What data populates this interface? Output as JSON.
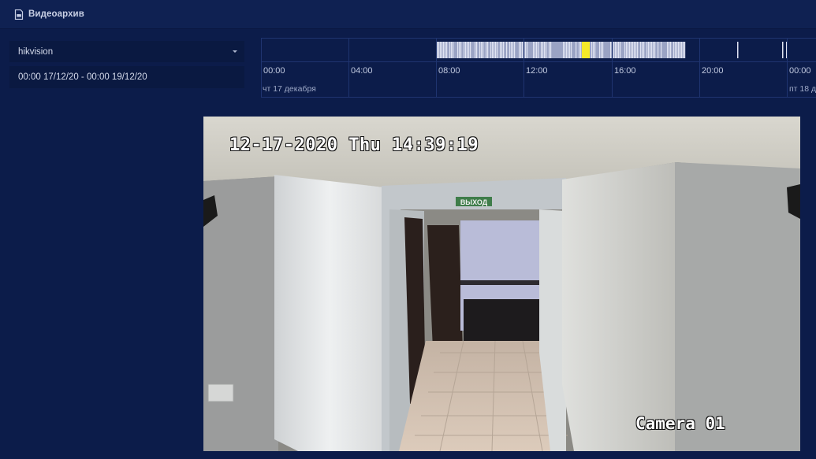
{
  "header": {
    "title": "Видеоархив",
    "icon": "document-video-icon"
  },
  "filters": {
    "camera_select": {
      "value": "hikvision"
    },
    "date_range": {
      "value": "00:00 17/12/20 - 00:00 19/12/20"
    }
  },
  "timeline": {
    "hour_labels": [
      "00:00",
      "04:00",
      "08:00",
      "12:00",
      "16:00",
      "20:00",
      "00:00"
    ],
    "day_labels": [
      "чт 17 декабря",
      "пт 18 д"
    ],
    "colors": {
      "recording": "#dfe3f2",
      "selected": "#f4e92a",
      "gridline": "#1f3470"
    }
  },
  "video": {
    "osd_timestamp": "12-17-2020 Thu 14:39:19",
    "osd_camera": "Camera 01",
    "exit_sign": "ВЫХОД"
  }
}
